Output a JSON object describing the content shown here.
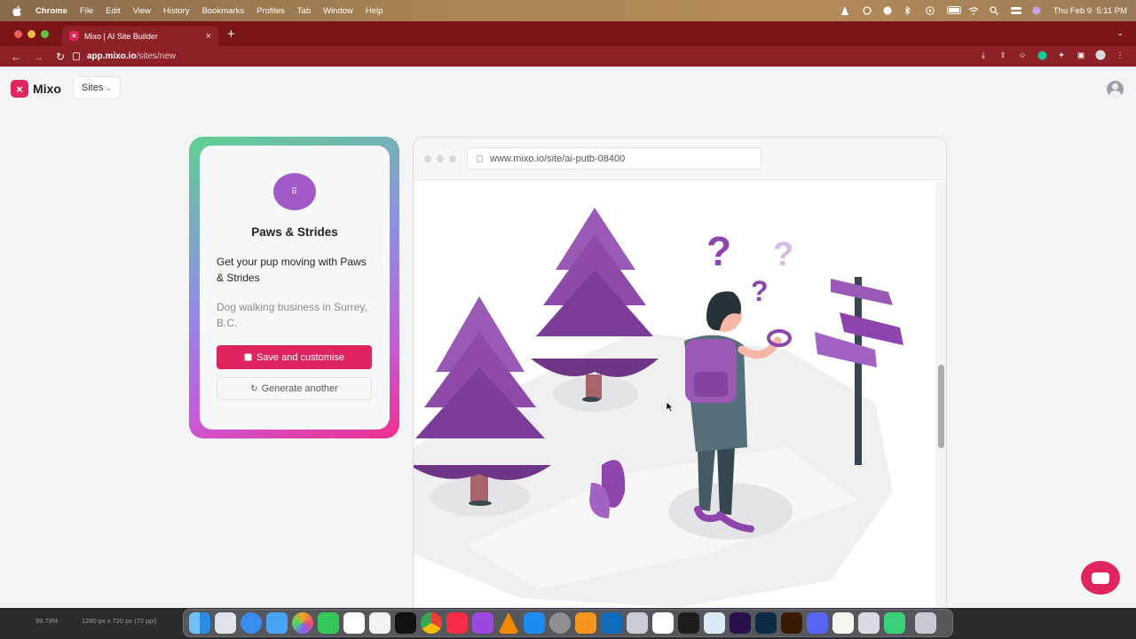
{
  "menubar": {
    "items": [
      "Chrome",
      "File",
      "Edit",
      "View",
      "History",
      "Bookmarks",
      "Profiles",
      "Tab",
      "Window",
      "Help"
    ],
    "datetime": "Thu Feb 9  5:11 PM"
  },
  "browser": {
    "tab_title": "Mixo | AI Site Builder",
    "url_host": "app.mixo.io",
    "url_path": "/sites/new"
  },
  "app": {
    "logo_text": "Mixo",
    "sites_label": "Sites",
    "brand_color": "#e0245e"
  },
  "site_card": {
    "name": "Paws & Strides",
    "tagline": "Get your pup moving with Paws & Strides",
    "description": "Dog walking business in Surrey, B.C.",
    "save_label": "Save and customise",
    "generate_label": "Generate another"
  },
  "preview": {
    "url": "www.mixo.io/site/ai-putb-08400"
  },
  "dock": {
    "zoom": "99.79%",
    "size_info": "1280 px x 720 px (72 ppi)",
    "apps": [
      "finder",
      "launchpad",
      "safari",
      "mail",
      "photos",
      "facetime",
      "calendar",
      "reminders",
      "apple-tv",
      "chrome",
      "music",
      "podcasts",
      "vlc",
      "app-store",
      "system-preferences",
      "books",
      "outlook",
      "script-editor",
      "slack",
      "word",
      "preview",
      "premiere",
      "photoshop",
      "illustrator",
      "discord",
      "notes",
      "screenshot",
      "facetime-2",
      "trash"
    ]
  }
}
